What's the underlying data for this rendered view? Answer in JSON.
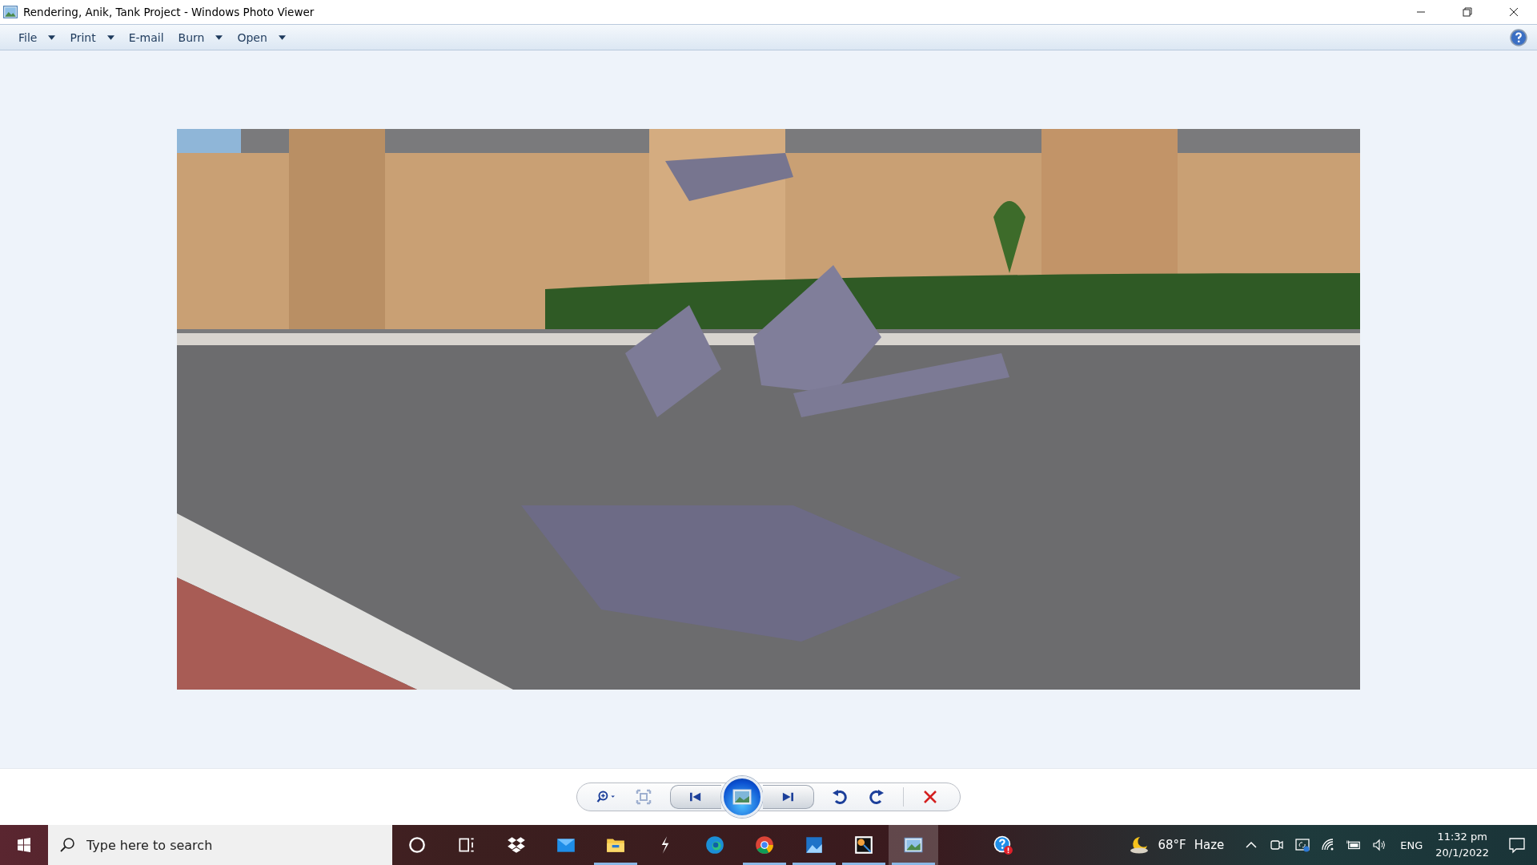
{
  "window": {
    "title": "Rendering, Anik, Tank Project - Windows Photo Viewer"
  },
  "menu": [
    {
      "label": "File",
      "dropdown": true
    },
    {
      "label": "Print",
      "dropdown": true
    },
    {
      "label": "E-mail",
      "dropdown": false
    },
    {
      "label": "Burn",
      "dropdown": true
    },
    {
      "label": "Open",
      "dropdown": true
    }
  ],
  "taskbar": {
    "search": {
      "placeholder": "Type here to search"
    },
    "apps": [
      {
        "kind": "cortana",
        "running": false,
        "selected": false
      },
      {
        "kind": "taskview",
        "running": false,
        "selected": false
      },
      {
        "kind": "dropbox",
        "running": false,
        "selected": false
      },
      {
        "kind": "mail",
        "running": false,
        "selected": false
      },
      {
        "kind": "explorer",
        "running": true,
        "selected": false
      },
      {
        "kind": "bolt",
        "running": false,
        "selected": false
      },
      {
        "kind": "edge",
        "running": false,
        "selected": false
      },
      {
        "kind": "chrome",
        "running": true,
        "selected": false
      },
      {
        "kind": "photos",
        "running": true,
        "selected": false
      },
      {
        "kind": "media",
        "running": true,
        "selected": false
      },
      {
        "kind": "viewer",
        "running": true,
        "selected": true
      },
      {
        "kind": "help",
        "running": false,
        "selected": false
      }
    ],
    "weather": {
      "temperature": "68°F",
      "condition": "Haze"
    },
    "language": "ENG",
    "time": "11:32 pm",
    "date": "20/1/2022"
  }
}
